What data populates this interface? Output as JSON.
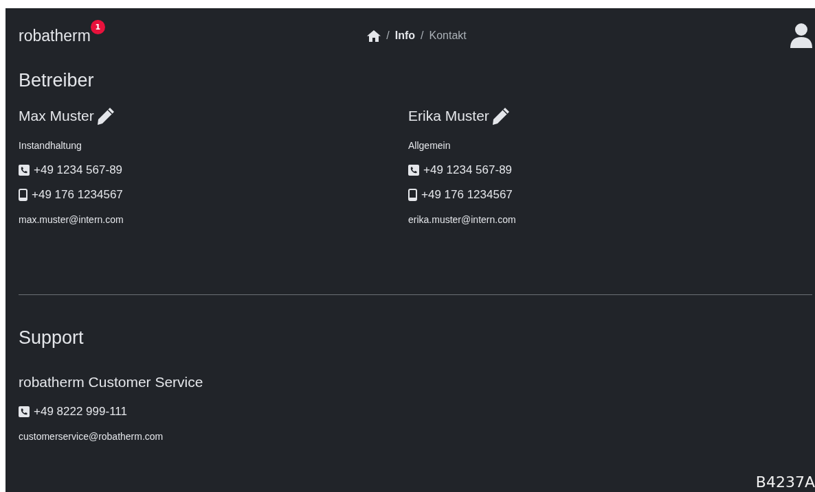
{
  "header": {
    "brand": "robatherm",
    "notification_count": "1",
    "breadcrumb_separator": "/",
    "breadcrumb": [
      {
        "label": "Info",
        "selected": false
      },
      {
        "label": "Kontakt",
        "selected": true
      }
    ]
  },
  "sections": [
    {
      "title": "Betreiber",
      "divider": true,
      "contacts": [
        {
          "name": "Max Muster",
          "editable": true,
          "lines": [
            {
              "kind": "department",
              "text": "Instandhaltung"
            },
            {
              "kind": "phone",
              "text": "+49 1234 567-89"
            },
            {
              "kind": "mobile",
              "text": "+49 176 1234567"
            },
            {
              "kind": "email",
              "text": "max.muster@intern.com"
            }
          ]
        },
        {
          "name": "Erika Muster",
          "editable": true,
          "lines": [
            {
              "kind": "department",
              "text": "Allgemein"
            },
            {
              "kind": "phone",
              "text": "+49 1234 567-89"
            },
            {
              "kind": "mobile",
              "text": "+49 176 1234567"
            },
            {
              "kind": "email",
              "text": "erika.muster@intern.com"
            }
          ]
        }
      ]
    },
    {
      "title": "Support",
      "divider": false,
      "contacts": [
        {
          "name": "robatherm Customer Service",
          "editable": false,
          "lines": [
            {
              "kind": "phone",
              "text": "+49 8222 999-111"
            },
            {
              "kind": "email",
              "text": "customerservice@robatherm.com"
            }
          ]
        }
      ]
    }
  ],
  "figure_code": "B4237A"
}
